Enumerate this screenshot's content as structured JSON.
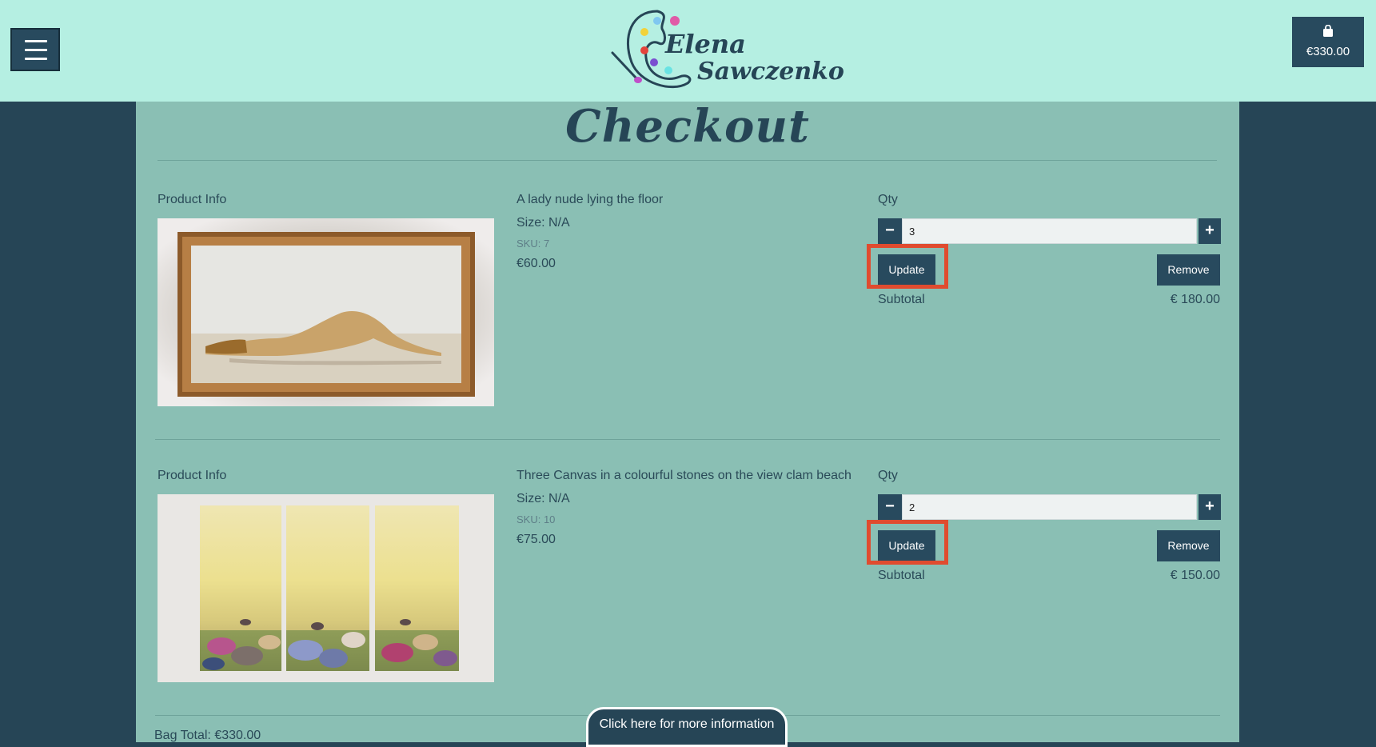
{
  "header": {
    "logo_line1": "Elena",
    "logo_line2": "Sawczenko",
    "cart_total": "€330.00"
  },
  "page": {
    "title": "Checkout"
  },
  "items": [
    {
      "section_label": "Product Info",
      "name": "A lady nude lying the floor",
      "size": "Size: N/A",
      "sku": "SKU: 7",
      "price": "€60.00",
      "qty_label": "Qty",
      "qty_value": "3",
      "update_label": "Update",
      "remove_label": "Remove",
      "subtotal_label": "Subtotal",
      "subtotal_value": "€ 180.00"
    },
    {
      "section_label": "Product Info",
      "name": "Three Canvas in a colourful stones on the view clam beach",
      "size": "Size: N/A",
      "sku": "SKU: 10",
      "price": "€75.00",
      "qty_label": "Qty",
      "qty_value": "2",
      "update_label": "Update",
      "remove_label": "Remove",
      "subtotal_label": "Subtotal",
      "subtotal_value": "€ 150.00"
    }
  ],
  "bag_total": "Bag Total: €330.00",
  "info_button": "Click here for more information",
  "colors": {
    "header_bg": "#b5efe2",
    "content_bg": "#8abfb4",
    "page_bg": "#264556",
    "button_bg": "#284a5e",
    "highlight": "#e04b2f"
  }
}
